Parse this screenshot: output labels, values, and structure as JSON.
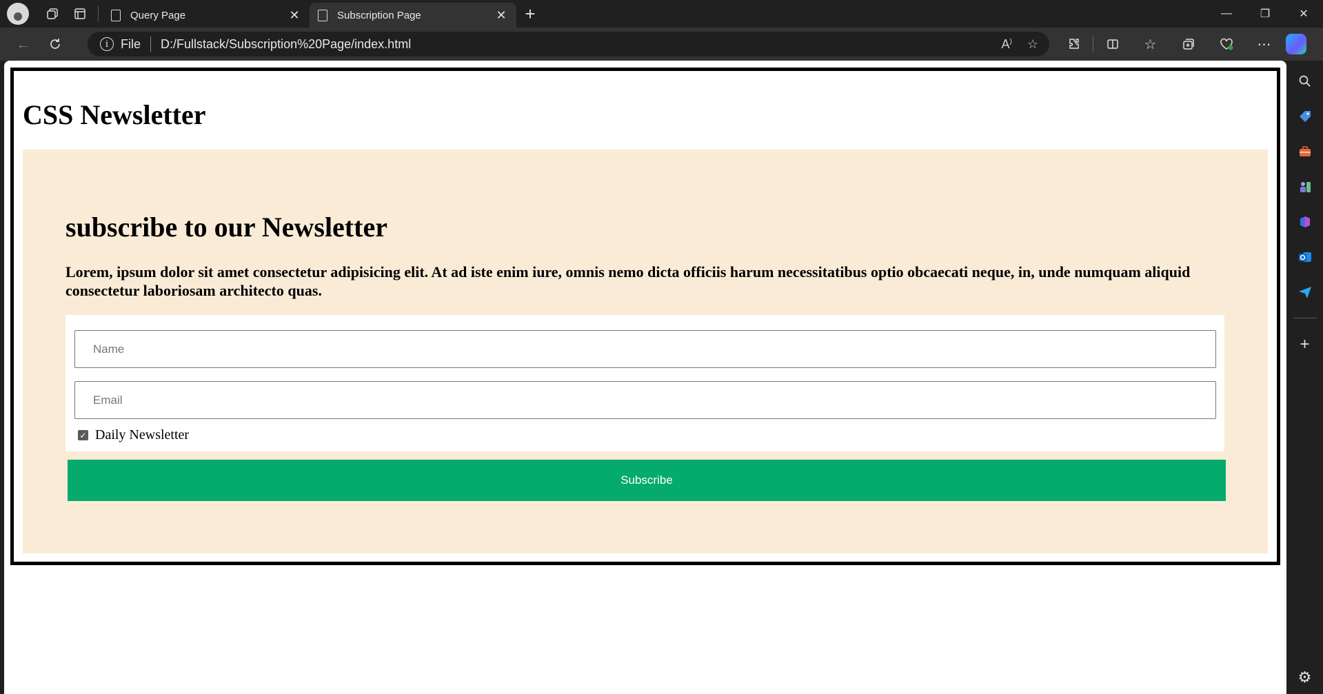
{
  "browser": {
    "tabs": [
      {
        "label": "Query Page",
        "active": false
      },
      {
        "label": "Subscription Page",
        "active": true
      }
    ],
    "address": {
      "scheme_label": "File",
      "url": "D:/Fullstack/Subscription%20Page/index.html"
    }
  },
  "page": {
    "title": "CSS Newsletter",
    "newsletter": {
      "heading": "subscribe to our Newsletter",
      "description": "Lorem, ipsum dolor sit amet consectetur adipisicing elit. At ad iste enim iure, omnis nemo dicta officiis harum necessitatibus optio obcaecati neque, in, unde numquam aliquid consectetur laboriosam architecto quas.",
      "name_placeholder": "Name",
      "email_placeholder": "Email",
      "checkbox_label": "Daily Newsletter",
      "checkbox_checked": true,
      "submit_label": "Subscribe"
    }
  },
  "colors": {
    "newsletter_bg": "#faebd7",
    "button_bg": "#05aa6d",
    "chrome_dark": "#202020"
  }
}
